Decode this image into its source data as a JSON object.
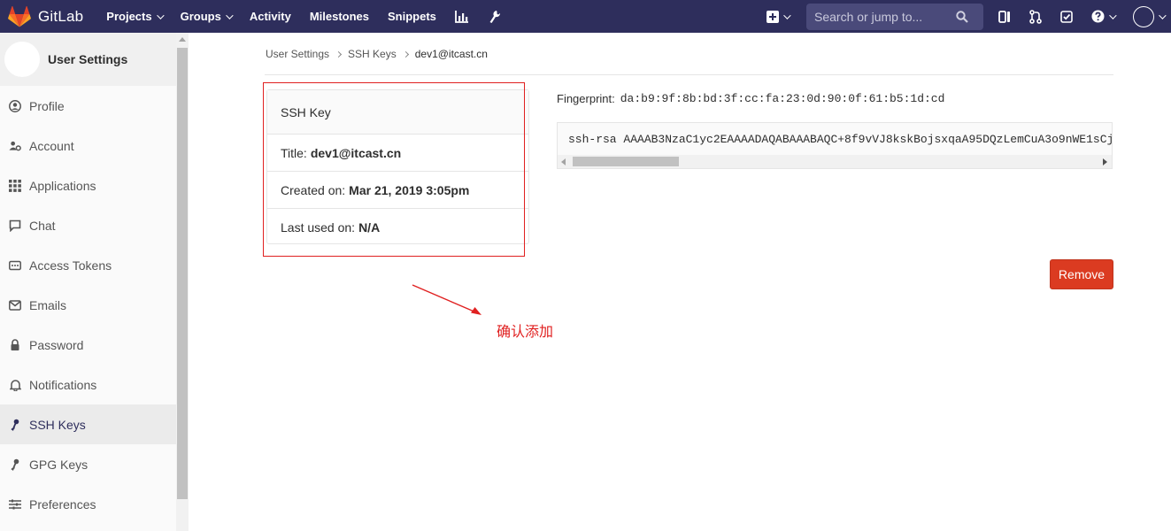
{
  "navbar": {
    "brand": "GitLab",
    "links": [
      {
        "label": "Projects",
        "dropdown": true
      },
      {
        "label": "Groups",
        "dropdown": true
      },
      {
        "label": "Activity",
        "dropdown": false
      },
      {
        "label": "Milestones",
        "dropdown": false
      },
      {
        "label": "Snippets",
        "dropdown": false
      }
    ],
    "search_placeholder": "Search or jump to...",
    "icons": [
      "chart-icon",
      "wrench-icon",
      "plus-square-icon",
      "search-icon",
      "sidebar-toggle-icon",
      "merge-request-icon",
      "todo-check-icon",
      "help-icon",
      "user-avatar"
    ]
  },
  "sidebar": {
    "title": "User Settings",
    "items": [
      {
        "label": "Profile",
        "icon": "profile-icon",
        "active": false
      },
      {
        "label": "Account",
        "icon": "account-gear-icon",
        "active": false
      },
      {
        "label": "Applications",
        "icon": "applications-grid-icon",
        "active": false
      },
      {
        "label": "Chat",
        "icon": "chat-icon",
        "active": false
      },
      {
        "label": "Access Tokens",
        "icon": "access-token-icon",
        "active": false
      },
      {
        "label": "Emails",
        "icon": "email-icon",
        "active": false
      },
      {
        "label": "Password",
        "icon": "lock-icon",
        "active": false
      },
      {
        "label": "Notifications",
        "icon": "bell-icon",
        "active": false
      },
      {
        "label": "SSH Keys",
        "icon": "key-icon",
        "active": true
      },
      {
        "label": "GPG Keys",
        "icon": "key-icon",
        "active": false
      },
      {
        "label": "Preferences",
        "icon": "preferences-icon",
        "active": false
      }
    ]
  },
  "breadcrumb": [
    "User Settings",
    "SSH Keys",
    "dev1@itcast.cn"
  ],
  "key_card": {
    "header": "SSH Key",
    "title_label": "Title:",
    "title_value": "dev1@itcast.cn",
    "created_label": "Created on:",
    "created_value": "Mar 21, 2019 3:05pm",
    "last_used_label": "Last used on:",
    "last_used_value": "N/A"
  },
  "fingerprint": {
    "label": "Fingerprint:",
    "value": "da:b9:9f:8b:bd:3f:cc:fa:23:0d:90:0f:61:b5:1d:cd"
  },
  "public_key": "ssh-rsa AAAAB3NzaC1yc2EAAAADAQABAAABAQC+8f9vVJ8kskBojsxqaA95DQzLemCuA3o9nWE1sCj",
  "remove_label": "Remove",
  "annotation": "确认添加",
  "colors": {
    "navbar": "#2e2e5c",
    "remove_button": "#db3b21",
    "annotation": "#e02020",
    "logo_orange": "#fc6d26"
  }
}
